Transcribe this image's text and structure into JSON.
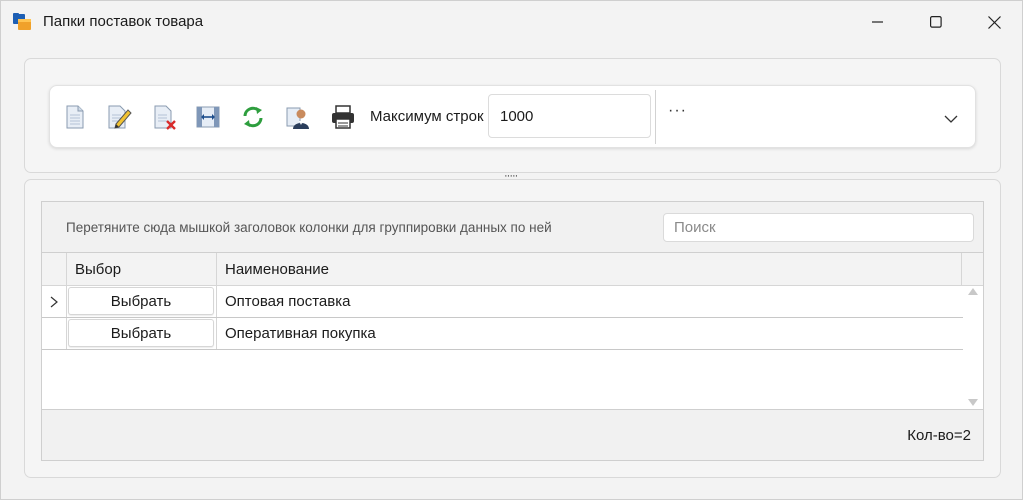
{
  "window": {
    "title": "Папки поставок товара",
    "controls": [
      "minimize",
      "maximize",
      "close"
    ]
  },
  "toolbar": {
    "icons": [
      "new-document-icon",
      "edit-document-icon",
      "delete-document-icon",
      "columns-icon",
      "refresh-icon",
      "user-icon",
      "print-icon"
    ],
    "max_rows_label": "Максимум строк",
    "max_rows_value": "1000",
    "more_label": "···"
  },
  "grid": {
    "group_hint": "Перетяните сюда мышкой заголовок колонки для группировки данных по ней",
    "search_placeholder": "Поиск",
    "columns": [
      "Выбор",
      "Наименование"
    ],
    "rows": [
      {
        "button": "Выбрать",
        "name": "Оптовая поставка",
        "current": true
      },
      {
        "button": "Выбрать",
        "name": "Оперативная покупка",
        "current": false
      }
    ],
    "count_label": "Кол-во=2"
  },
  "colors": {
    "refresh": "#2e9e3e",
    "folder_blue": "#1e5fb4",
    "folder_orange": "#f0a12a",
    "delete_red": "#d92b2b"
  }
}
